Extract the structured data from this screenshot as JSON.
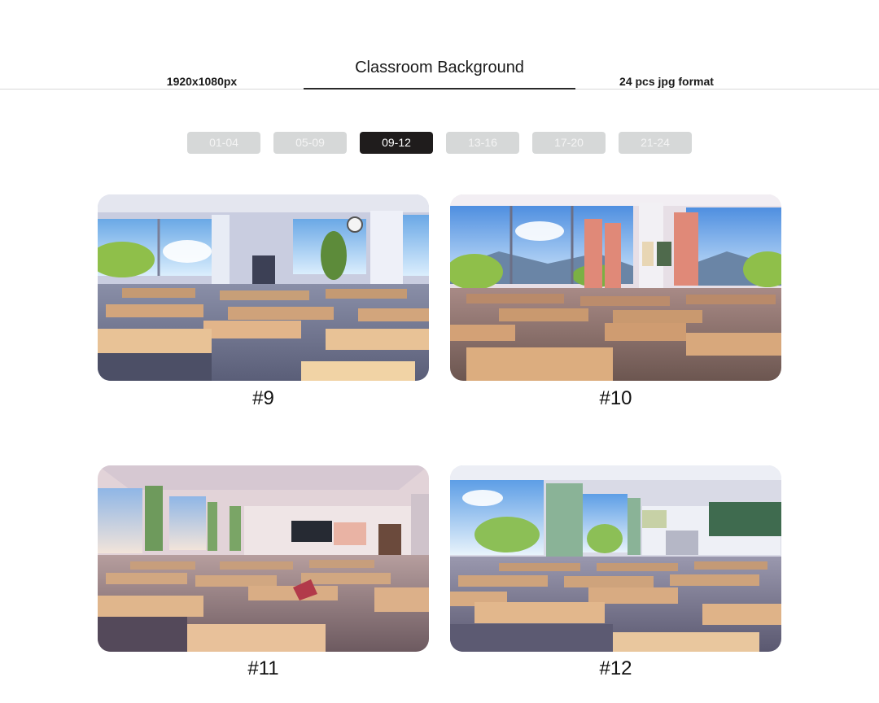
{
  "header": {
    "title": "Classroom Background",
    "resolution": "1920x1080px",
    "format_info": "24 pcs jpg format"
  },
  "tabs": [
    {
      "label": "01-04",
      "active": false
    },
    {
      "label": "05-09",
      "active": false
    },
    {
      "label": "09-12",
      "active": true
    },
    {
      "label": "13-16",
      "active": false
    },
    {
      "label": "17-20",
      "active": false
    },
    {
      "label": "21-24",
      "active": false
    }
  ],
  "gallery": [
    {
      "caption": "#9"
    },
    {
      "caption": "#10"
    },
    {
      "caption": "#11"
    },
    {
      "caption": "#12"
    }
  ],
  "colors": {
    "active_tab": "#1f1c1c",
    "inactive_tab": "#d6d8d8",
    "divider": "#d8d8d8"
  }
}
